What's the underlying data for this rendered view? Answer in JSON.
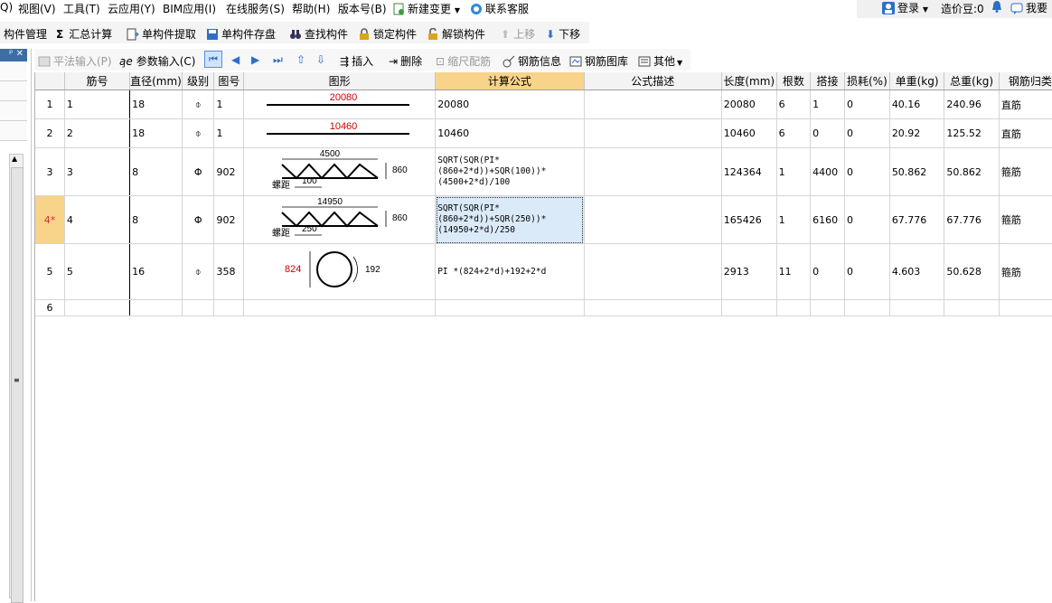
{
  "menubar": {
    "items": [
      "Q)",
      "视图(V)",
      "工具(T)",
      "云应用(Y)",
      "BIM应用(I)",
      "在线服务(S)",
      "帮助(H)",
      "版本号(B)",
      "新建变更",
      "联系客服"
    ],
    "login": "登录",
    "cost_beans": "造价豆:0",
    "want": "我要"
  },
  "toolbar1": {
    "items": [
      "构件管理",
      "汇总计算",
      "单构件提取",
      "单构件存盘",
      "查找构件",
      "锁定构件",
      "解锁构件",
      "上移",
      "下移"
    ]
  },
  "toolbar2": {
    "items": [
      "平法输入(P)",
      "参数输入(C)",
      "插入",
      "删除",
      "缩尺配筋",
      "钢筋信息",
      "钢筋图库",
      "其他"
    ]
  },
  "table": {
    "columns": [
      "筋号",
      "直径(mm)",
      "级别",
      "图号",
      "图形",
      "计算公式",
      "公式描述",
      "长度(mm)",
      "根数",
      "搭接",
      "损耗(%)",
      "单重(kg)",
      "总重(kg)",
      "钢筋归类"
    ],
    "rows": [
      {
        "rownum": "1",
        "name": "1",
        "dia": "18",
        "grade": "⌽",
        "fig": "1",
        "formula": "20080",
        "desc": "",
        "length": "20080",
        "count": "6",
        "lap": "1",
        "loss": "0",
        "unit_w": "40.16",
        "total_w": "240.96",
        "cls": "直筋"
      },
      {
        "rownum": "2",
        "name": "2",
        "dia": "18",
        "grade": "⌽",
        "fig": "1",
        "formula": "10460",
        "desc": "",
        "length": "10460",
        "count": "6",
        "lap": "0",
        "loss": "0",
        "unit_w": "20.92",
        "total_w": "125.52",
        "cls": "直筋"
      },
      {
        "rownum": "3",
        "name": "3",
        "dia": "8",
        "grade": "Φ",
        "fig": "902",
        "formula": "SQRT(SQR(PI*(860+2*d))+SQR(100))*(4500+2*d)/100",
        "desc": "",
        "length": "124364",
        "count": "1",
        "lap": "4400",
        "loss": "0",
        "unit_w": "50.862",
        "total_w": "50.862",
        "cls": "箍筋"
      },
      {
        "rownum": "4*",
        "name": "4",
        "dia": "8",
        "grade": "Φ",
        "fig": "902",
        "formula": "SQRT(SQR(PI*(860+2*d))+SQR(250))*(14950+2*d)/250",
        "desc": "",
        "length": "165426",
        "count": "1",
        "lap": "6160",
        "loss": "0",
        "unit_w": "67.776",
        "total_w": "67.776",
        "cls": "箍筋"
      },
      {
        "rownum": "5",
        "name": "5",
        "dia": "16",
        "grade": "⌽",
        "fig": "358",
        "formula": "PI *(824+2*d)+192+2*d",
        "desc": "",
        "length": "2913",
        "count": "11",
        "lap": "0",
        "loss": "0",
        "unit_w": "4.603",
        "total_w": "50.628",
        "cls": "箍筋"
      },
      {
        "rownum": "6",
        "name": "",
        "dia": "",
        "grade": "",
        "fig": "",
        "formula": "",
        "desc": "",
        "length": "",
        "count": "",
        "lap": "",
        "loss": "",
        "unit_w": "",
        "total_w": "",
        "cls": ""
      }
    ]
  },
  "shapes": {
    "r1_len": "20080",
    "r2_len": "10460",
    "r3_len": "4500",
    "r3_h": "860",
    "r3_pitch": "100",
    "r4_len": "14950",
    "r4_h": "860",
    "r4_pitch": "250",
    "pitch_label": "螺距",
    "r5_d": "824",
    "r5_hook": "192"
  },
  "colors": {
    "accent_header": "#f8d38a",
    "selected_cell": "#dbeaf8",
    "dim_red": "#cc0000"
  }
}
